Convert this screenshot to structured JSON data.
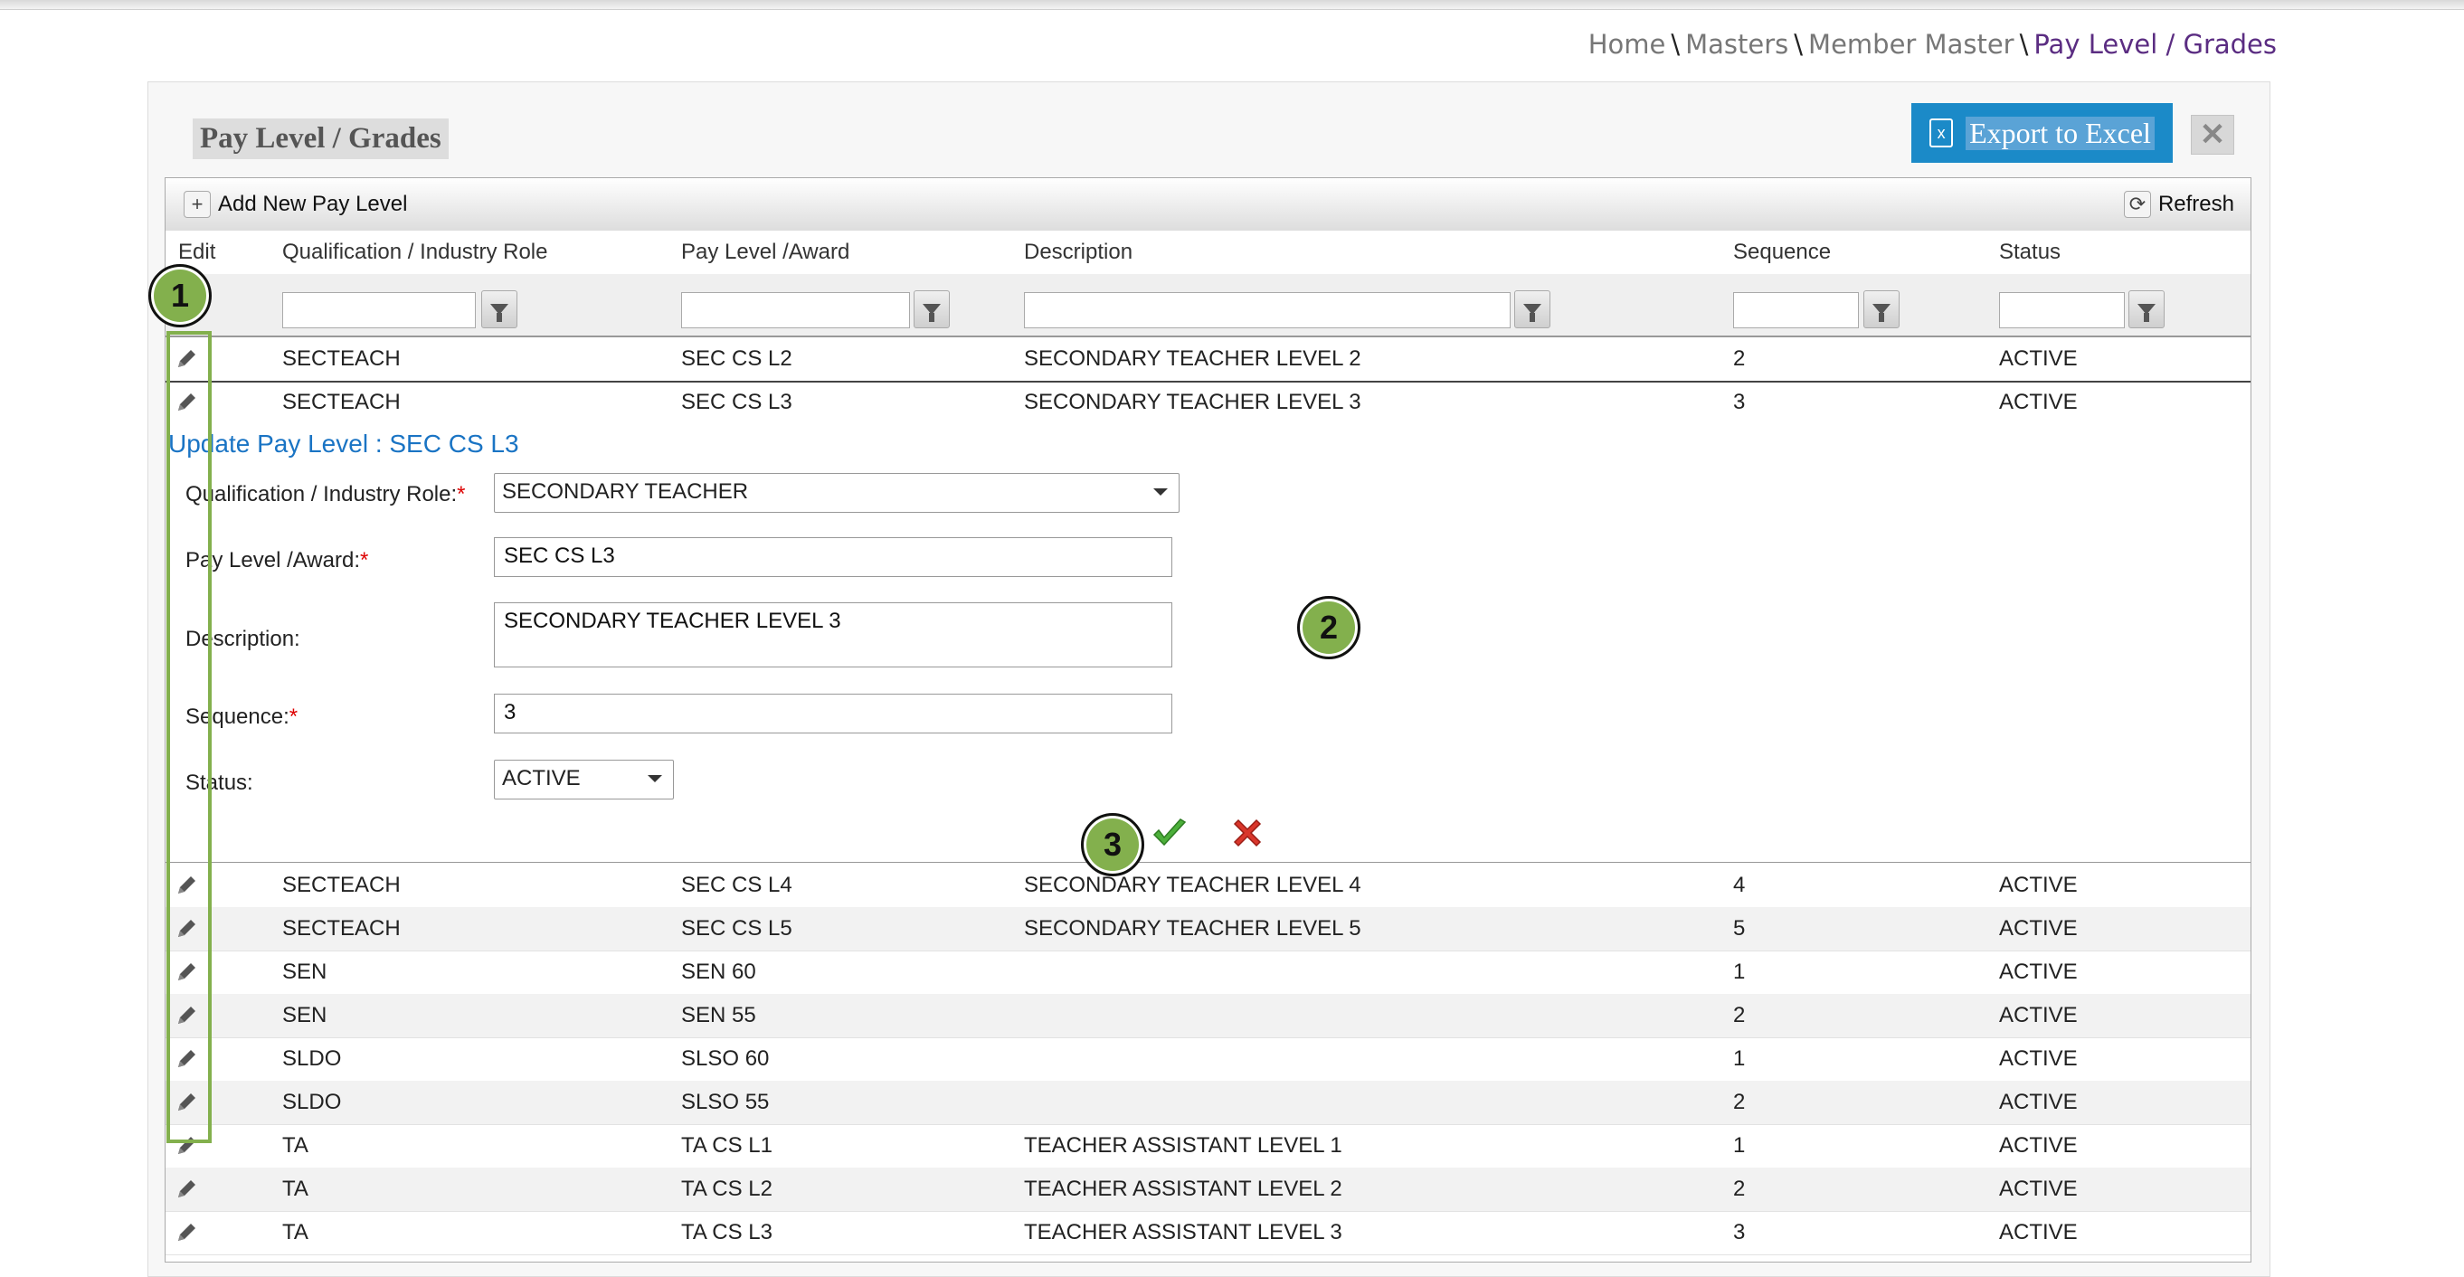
{
  "breadcrumb": [
    {
      "label": "Home",
      "current": false
    },
    {
      "label": "Masters",
      "current": false
    },
    {
      "label": "Member Master",
      "current": false
    },
    {
      "label": "Pay Level / Grades",
      "current": true
    }
  ],
  "panel": {
    "title": "Pay Level / Grades",
    "export_label": "Export to Excel",
    "close_icon": "close-icon"
  },
  "toolbar": {
    "add_label": "Add New Pay Level",
    "refresh_label": "Refresh"
  },
  "columns": {
    "edit": "Edit",
    "qualification": "Qualification / Industry Role",
    "paylevel": "Pay Level /Award",
    "description": "Description",
    "sequence": "Sequence",
    "status": "Status"
  },
  "rows_top": [
    {
      "qualification": "SECTEACH",
      "paylevel": "SEC CS L2",
      "description": "SECONDARY TEACHER LEVEL 2",
      "sequence": "2",
      "status": "ACTIVE"
    },
    {
      "qualification": "SECTEACH",
      "paylevel": "SEC CS L3",
      "description": "SECONDARY TEACHER LEVEL 3",
      "sequence": "3",
      "status": "ACTIVE"
    }
  ],
  "edit_form": {
    "title": "Update Pay Level : SEC CS L3",
    "qualification_label": "Qualification / Industry Role:",
    "qualification_value": "SECONDARY TEACHER",
    "paylevel_label": "Pay Level /Award:",
    "paylevel_value": "SEC CS L3",
    "description_label": "Description:",
    "description_value": "SECONDARY TEACHER LEVEL 3",
    "sequence_label": "Sequence:",
    "sequence_value": "3",
    "status_label": "Status:",
    "status_value": "ACTIVE",
    "required_mark": "*"
  },
  "rows_bottom": [
    {
      "qualification": "SECTEACH",
      "paylevel": "SEC CS L4",
      "description": "SECONDARY TEACHER LEVEL 4",
      "sequence": "4",
      "status": "ACTIVE"
    },
    {
      "qualification": "SECTEACH",
      "paylevel": "SEC CS L5",
      "description": "SECONDARY TEACHER LEVEL 5",
      "sequence": "5",
      "status": "ACTIVE"
    },
    {
      "qualification": "SEN",
      "paylevel": "SEN 60",
      "description": "",
      "sequence": "1",
      "status": "ACTIVE"
    },
    {
      "qualification": "SEN",
      "paylevel": "SEN 55",
      "description": "",
      "sequence": "2",
      "status": "ACTIVE"
    },
    {
      "qualification": "SLDO",
      "paylevel": "SLSO 60",
      "description": "",
      "sequence": "1",
      "status": "ACTIVE"
    },
    {
      "qualification": "SLDO",
      "paylevel": "SLSO 55",
      "description": "",
      "sequence": "2",
      "status": "ACTIVE"
    },
    {
      "qualification": "TA",
      "paylevel": "TA CS L1",
      "description": "TEACHER ASSISTANT LEVEL 1",
      "sequence": "1",
      "status": "ACTIVE"
    },
    {
      "qualification": "TA",
      "paylevel": "TA CS L2",
      "description": "TEACHER ASSISTANT LEVEL 2",
      "sequence": "2",
      "status": "ACTIVE"
    },
    {
      "qualification": "TA",
      "paylevel": "TA CS L3",
      "description": "TEACHER ASSISTANT LEVEL 3",
      "sequence": "3",
      "status": "ACTIVE"
    }
  ],
  "badges": {
    "one": "1",
    "two": "2",
    "three": "3"
  },
  "colors": {
    "accent": "#1b8ac8",
    "link": "#1a74c4",
    "breadcrumb_current": "#5b2d82",
    "annotation": "#83b04d"
  }
}
